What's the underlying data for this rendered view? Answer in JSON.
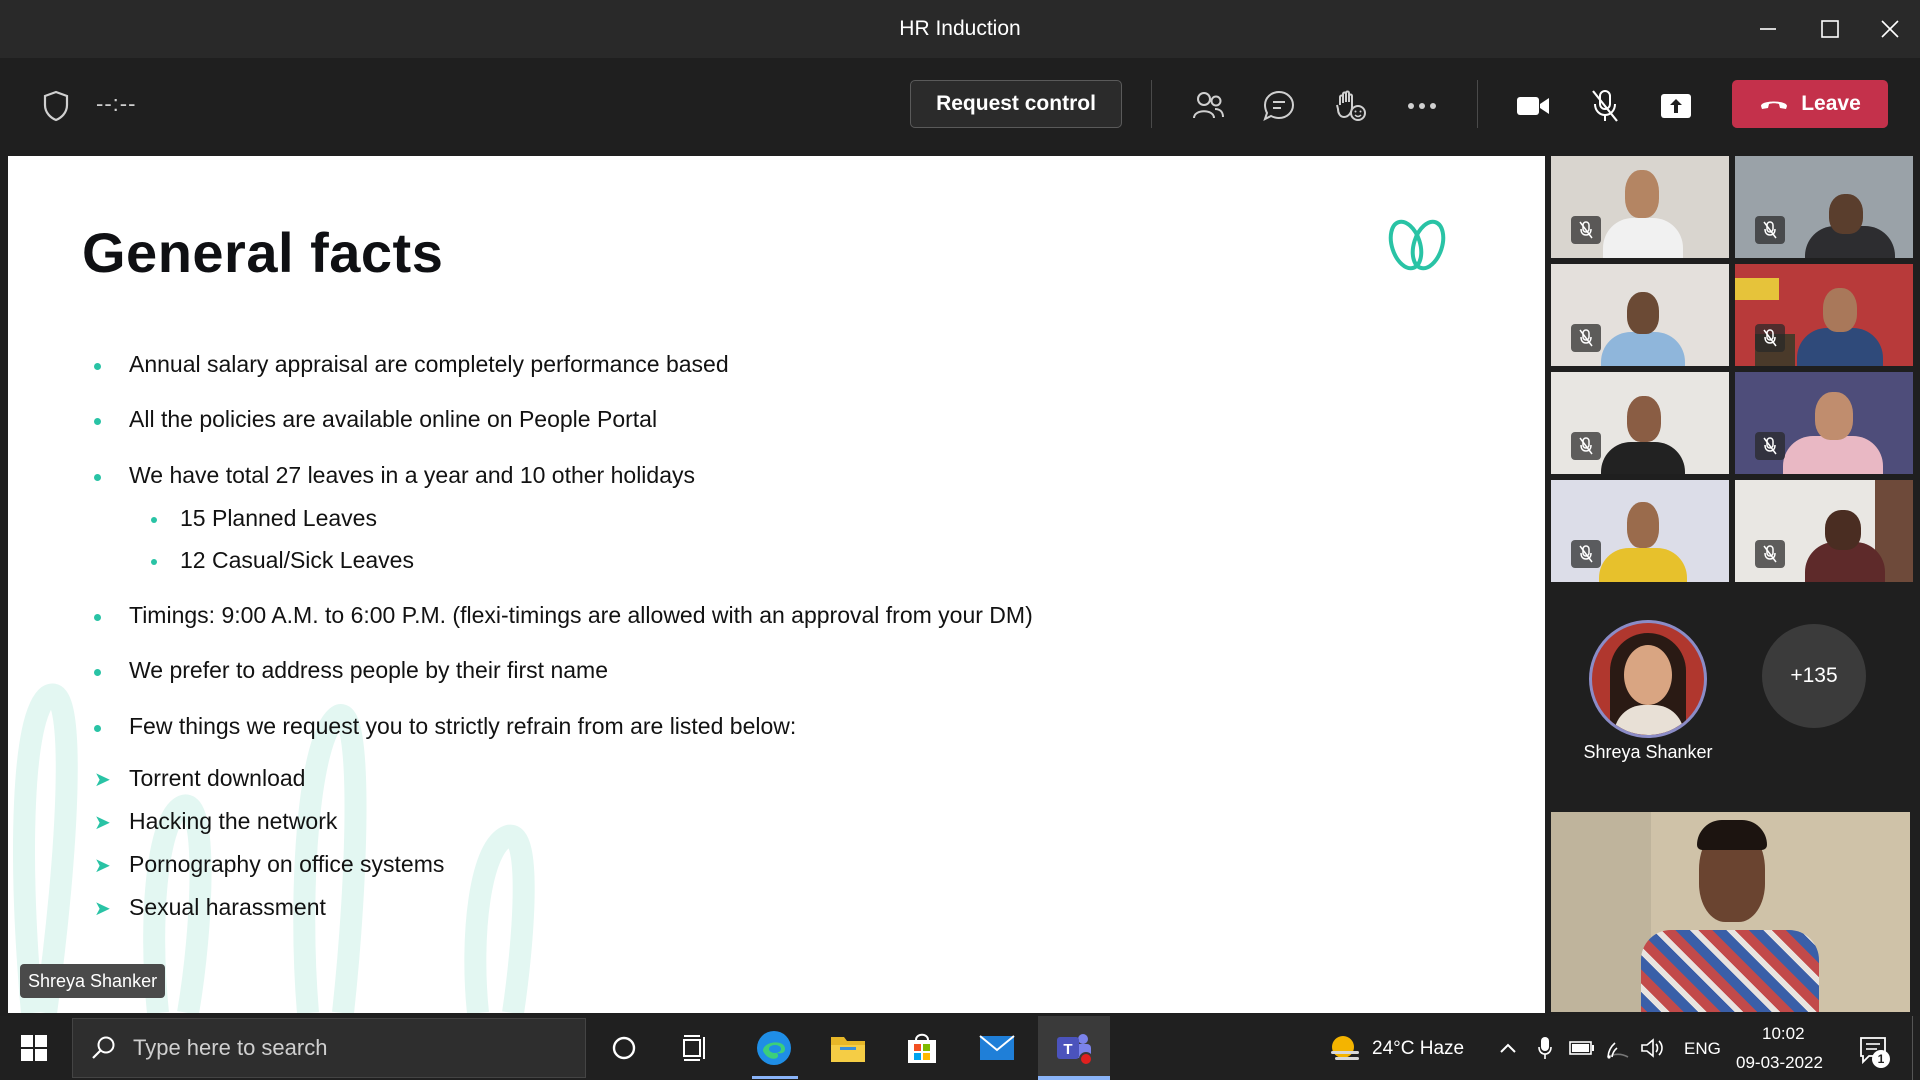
{
  "window": {
    "title": "HR Induction"
  },
  "toolbar": {
    "timer": "--:--",
    "request_control": "Request control",
    "leave": "Leave",
    "icons": [
      "shield-icon",
      "participants-icon",
      "chat-icon",
      "react-icon",
      "more-icon",
      "camera-icon",
      "mic-off-icon",
      "share-icon",
      "phone-hangup-icon"
    ]
  },
  "slide": {
    "title": "General facts",
    "bullets": [
      "Annual salary appraisal are completely performance based",
      "All the policies are available online on People Portal",
      "We have total 27 leaves in a year and 10 other holidays"
    ],
    "sub_bullets": [
      "15 Planned Leaves",
      "12 Casual/Sick Leaves"
    ],
    "bullets2": [
      "Timings: 9:00 A.M.  to 6:00 P.M. (flexi-timings are allowed with an approval from your DM)",
      "We prefer to address people by their first name",
      "Few things we request you to strictly refrain from are listed below:"
    ],
    "arrows": [
      "Torrent download",
      "Hacking the network",
      "Pornography on office systems",
      "Sexual harassment"
    ],
    "presenter": "Shreya Shanker",
    "accent_color": "#29c3a5"
  },
  "gallery": {
    "featured_name": "Shreya Shanker",
    "overflow_count": "+135"
  },
  "taskbar": {
    "search_placeholder": "Type here to search",
    "weather": "24°C  Haze",
    "language": "ENG",
    "time": "10:02",
    "date": "09-03-2022",
    "notification_count": "1"
  }
}
